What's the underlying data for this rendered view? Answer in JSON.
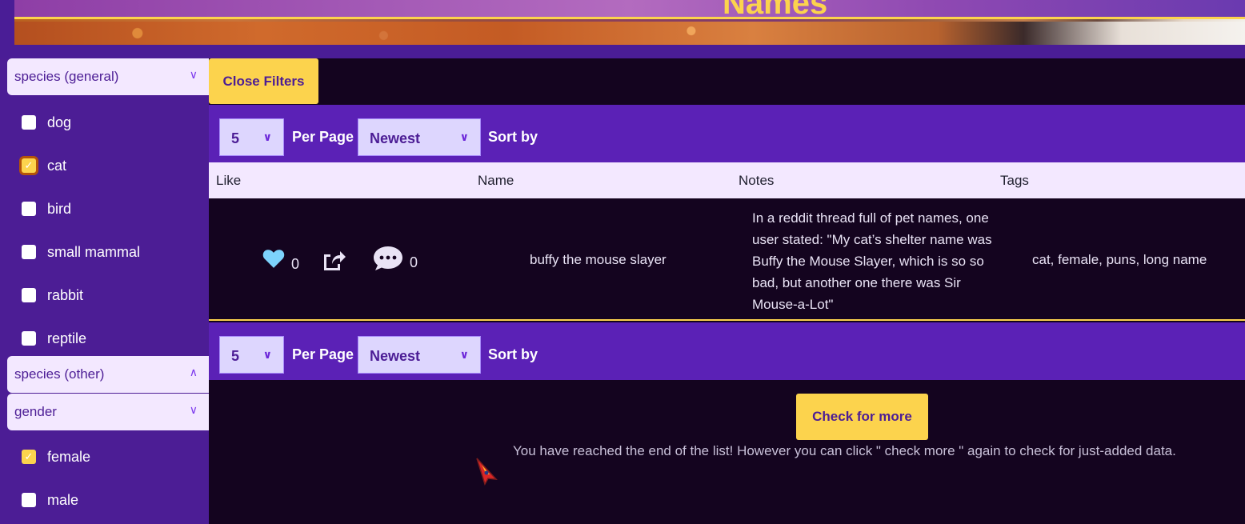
{
  "header": {
    "title": "Names"
  },
  "sidebar": {
    "sections": [
      {
        "title": "species (general)",
        "chevron": "chevron-down-icon"
      },
      {
        "title": "species (other)",
        "chevron": "chevron-up-icon"
      },
      {
        "title": "gender",
        "chevron": "chevron-down-icon"
      }
    ],
    "species_general": [
      {
        "label": "dog",
        "checked": false
      },
      {
        "label": "cat",
        "checked": true
      },
      {
        "label": "bird",
        "checked": false
      },
      {
        "label": "small mammal",
        "checked": false
      },
      {
        "label": "rabbit",
        "checked": false
      },
      {
        "label": "reptile",
        "checked": false
      }
    ],
    "gender": [
      {
        "label": "female",
        "checked": true
      },
      {
        "label": "male",
        "checked": false
      }
    ]
  },
  "main": {
    "close_filters": "Close Filters",
    "toolbar": {
      "per_page_value": "5",
      "per_page_label": "Per Page",
      "sort_value": "Newest",
      "sort_label": "Sort by"
    },
    "table": {
      "headers": [
        "Like",
        "Name",
        "Notes",
        "Tags"
      ],
      "rows": [
        {
          "likes": "0",
          "comments": "0",
          "name": "buffy the mouse slayer",
          "notes": "In a reddit thread full of pet names, one user stated: \"My cat’s shelter name was Buffy the Mouse Slayer, which is so so bad, but another one there was Sir Mouse-a-Lot\"",
          "tags": "cat, female, puns, long name"
        }
      ]
    },
    "check_more": "Check for more",
    "end_message": "You have reached the end of the list! However you can click \" check more \" again to check for just-added data."
  },
  "colors": {
    "accent": "#fcd34d",
    "brand_purple": "#5b21b6",
    "dark_bg": "#14041f",
    "sidebar_bg": "#4c1d95",
    "heart": "#7dd3fc"
  }
}
